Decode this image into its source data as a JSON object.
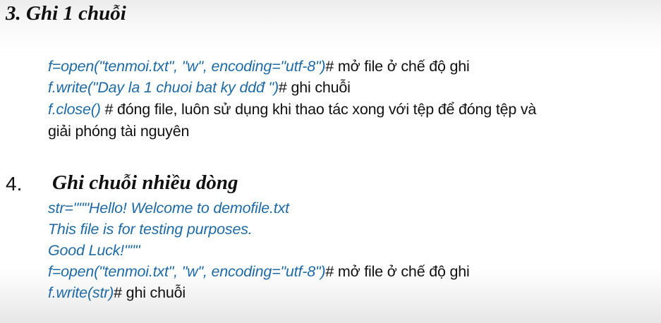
{
  "section3": {
    "title": "3. Ghi 1 chuỗi",
    "lines": [
      {
        "code": "f=open(\"tenmoi.txt\", \"w\",  encoding=\"utf-8\")",
        "comment": "# mở file ở chế độ ghi"
      },
      {
        "code": "f.write(\"Day la 1 chuoi bat ky ddđ \")",
        "comment": "# ghi chuỗi"
      },
      {
        "code": "f.close()",
        "comment": " # đóng file, luôn sử dụng khi thao tác xong với tệp để đóng tệp và"
      },
      {
        "code": "",
        "comment": "giải phóng tài nguyên"
      }
    ]
  },
  "section4": {
    "number": "4.",
    "title": "Ghi chuỗi nhiều dòng",
    "lines": [
      {
        "code": "str=\"\"\"Hello! Welcome to demofile.txt",
        "comment": ""
      },
      {
        "code": "This file is for testing purposes.",
        "comment": ""
      },
      {
        "code": "Good Luck!\"\"\"",
        "comment": ""
      },
      {
        "code": "f=open(\"tenmoi.txt\", \"w\",  encoding=\"utf-8\")",
        "comment": "# mở file ở chế độ ghi"
      },
      {
        "code": "f.write(str)",
        "comment": "# ghi chuỗi"
      }
    ]
  }
}
